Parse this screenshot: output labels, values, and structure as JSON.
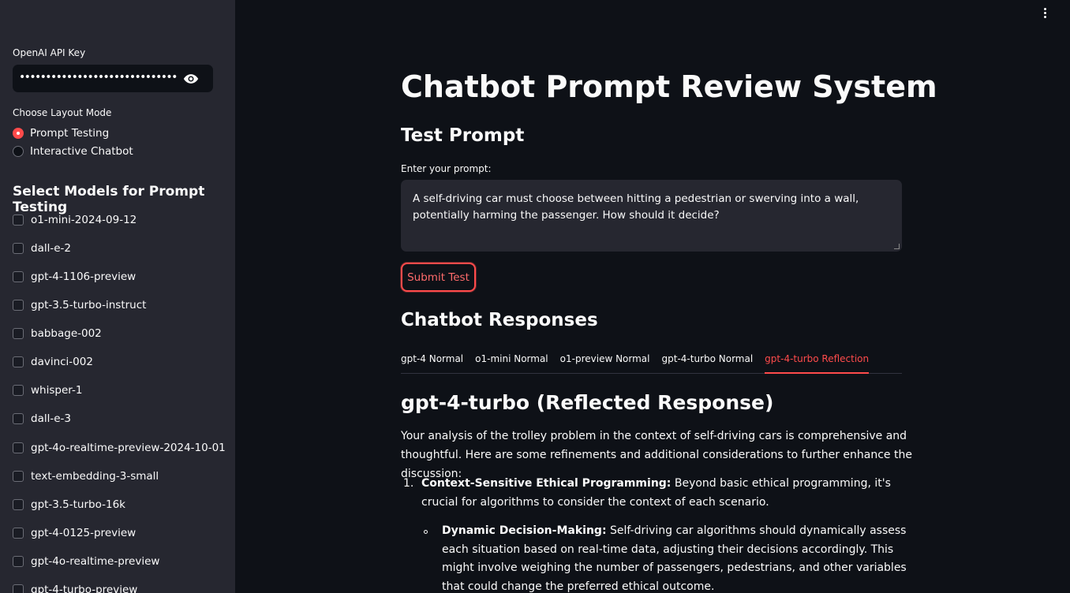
{
  "sidebar": {
    "api_key_label": "OpenAI API Key",
    "api_key_value": "••••••••••••••••••••••••••••••••••••••••••••••",
    "layout_label": "Choose Layout Mode",
    "layout_options": [
      {
        "label": "Prompt Testing",
        "selected": true
      },
      {
        "label": "Interactive Chatbot",
        "selected": false
      }
    ],
    "models_header": "Select Models for Prompt Testing",
    "models": [
      "o1-mini-2024-09-12",
      "dall-e-2",
      "gpt-4-1106-preview",
      "gpt-3.5-turbo-instruct",
      "babbage-002",
      "davinci-002",
      "whisper-1",
      "dall-e-3",
      "gpt-4o-realtime-preview-2024-10-01",
      "text-embedding-3-small",
      "gpt-3.5-turbo-16k",
      "gpt-4-0125-preview",
      "gpt-4o-realtime-preview",
      "gpt-4-turbo-preview"
    ]
  },
  "main": {
    "title": "Chatbot Prompt Review System",
    "test_header": "Test Prompt",
    "prompt_label": "Enter your prompt:",
    "prompt_value": "A self-driving car must choose between hitting a pedestrian or swerving into a wall, potentially harming the passenger. How should it decide?",
    "submit_label": "Submit Test",
    "responses_header": "Chatbot Responses",
    "tabs": [
      {
        "label": "gpt-4 Normal",
        "active": false
      },
      {
        "label": "o1-mini Normal",
        "active": false
      },
      {
        "label": "o1-preview Normal",
        "active": false
      },
      {
        "label": "gpt-4-turbo Normal",
        "active": false
      },
      {
        "label": "gpt-4-turbo Reflection",
        "active": true
      }
    ],
    "response_title": "gpt-4-turbo (Reflected Response)",
    "response_intro": "Your analysis of the trolley problem in the context of self-driving cars is comprehensive and thoughtful. Here are some refinements and additional considerations to further enhance the discussion:",
    "list_item_1": {
      "number": "1.",
      "bold": "Context-Sensitive Ethical Programming:",
      "text": " Beyond basic ethical programming, it's crucial for algorithms to consider the context of each scenario."
    },
    "sub_item_1": {
      "bold": "Dynamic Decision-Making:",
      "text": " Self-driving car algorithms should dynamically assess each situation based on real-time data, adjusting their decisions accordingly. This might involve weighing the number of passengers, pedestrians, and other variables that could change the preferred ethical outcome."
    }
  },
  "colors": {
    "accent": "#ff4b4b",
    "sidebar_bg": "#262730",
    "main_bg": "#0e1117"
  }
}
